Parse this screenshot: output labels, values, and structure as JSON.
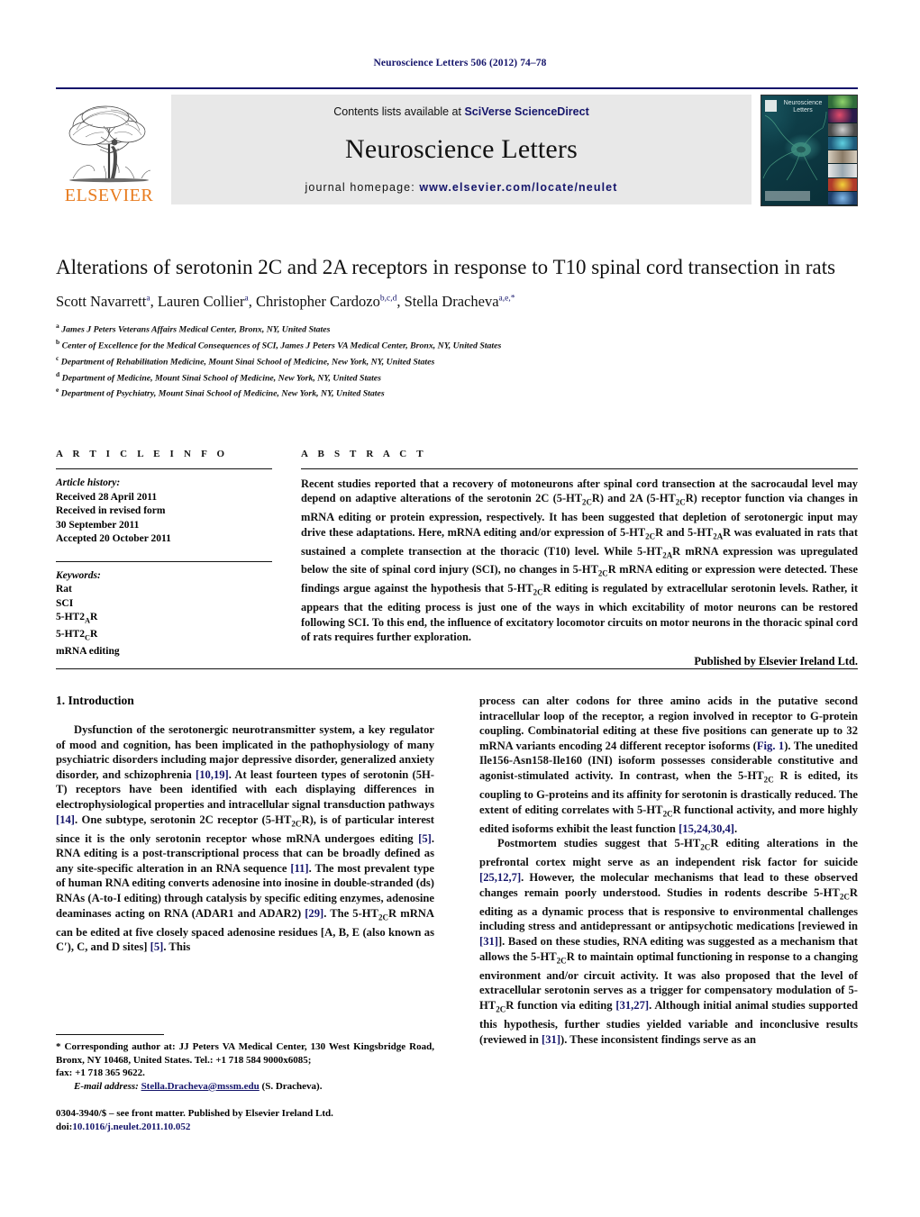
{
  "running_head": "Neuroscience Letters 506 (2012) 74–78",
  "masthead": {
    "contents_prefix": "Contents lists available at ",
    "contents_brand": "SciVerse ScienceDirect",
    "journal_title": "Neuroscience Letters",
    "homepage_prefix": "journal homepage: ",
    "homepage_url": "www.elsevier.com/locate/neulet",
    "publisher_logo_text": "ELSEVIER",
    "cover_title_line1": "Neuroscience",
    "cover_title_line2": "Letters"
  },
  "article": {
    "title": "Alterations of serotonin 2C and 2A receptors in response to T10 spinal cord transection in rats",
    "authors_html": "Scott Navarrett<sup>a</sup>, Lauren Collier<sup>a</sup>, Christopher Cardozo<sup>b,c,d</sup>, Stella Dracheva<sup>a,e,</sup><sup>*</sup>",
    "affiliations": [
      {
        "marker": "a",
        "text": "James J Peters Veterans Affairs Medical Center, Bronx, NY, United States"
      },
      {
        "marker": "b",
        "text": "Center of Excellence for the Medical Consequences of SCI, James J Peters VA Medical Center, Bronx, NY, United States"
      },
      {
        "marker": "c",
        "text": "Department of Rehabilitation Medicine, Mount Sinai School of Medicine, New York, NY, United States"
      },
      {
        "marker": "d",
        "text": "Department of Medicine, Mount Sinai School of Medicine, New York, NY, United States"
      },
      {
        "marker": "e",
        "text": "Department of Psychiatry, Mount Sinai School of Medicine, New York, NY, United States"
      }
    ]
  },
  "article_info": {
    "heading": "A R T I C L E   I N F O",
    "history_label": "Article history:",
    "history": [
      "Received 28 April 2011",
      "Received in revised form",
      "30 September 2011",
      "Accepted 20 October 2011"
    ],
    "keywords_label": "Keywords:",
    "keywords": [
      "Rat",
      "SCI",
      "5-HT2AR",
      "5-HT2CR",
      "mRNA editing"
    ]
  },
  "abstract": {
    "heading": "A B S T R A C T",
    "body_html": "Recent studies reported that a recovery of motoneurons after spinal cord transection at the sacrocaudal level may depend on adaptive alterations of the serotonin 2C (5-HT<sub>2C</sub>R) and 2A (5-HT<sub>2C</sub>R) receptor function via changes in mRNA editing or protein expression, respectively. It has been suggested that depletion of serotonergic input may drive these adaptations. Here, mRNA editing and/or expression of 5-HT<sub>2C</sub>R and 5-HT<sub>2A</sub>R was evaluated in rats that sustained a complete transection at the thoracic (T10) level. While 5-HT<sub>2A</sub>R mRNA expression was upregulated below the site of spinal cord injury (SCI), no changes in 5-HT<sub>2C</sub>R mRNA editing or expression were detected. These findings argue against the hypothesis that 5-HT<sub>2C</sub>R editing is regulated by extracellular serotonin levels. Rather, it appears that the editing process is just one of the ways in which excitability of motor neurons can be restored following SCI. To this end, the influence of excitatory locomotor circuits on motor neurons in the thoracic spinal cord of rats requires further exploration.",
    "published_by": "Published by Elsevier Ireland Ltd."
  },
  "body": {
    "section_number_title": "1.  Introduction",
    "left_column_html": "<p class=\"indent\">Dysfunction of the serotonergic neurotransmitter system, a key regulator of mood and cognition, has been implicated in the pathophysiology of many psychiatric disorders including major depressive disorder, generalized anxiety disorder, and schizophrenia <span class=\"ref\">[10,19]</span>. At least fourteen types of serotonin (5H-T) receptors have been identified with each displaying differences in electrophysiological properties and intracellular signal transduction pathways <span class=\"ref\">[14]</span>. One subtype, serotonin 2C receptor (5-HT<sub>2C</sub>R), is of particular interest since it is the only serotonin receptor whose mRNA undergoes editing <span class=\"ref\">[5]</span>. RNA editing is a post-transcriptional process that can be broadly defined as any site-specific alteration in an RNA sequence <span class=\"ref\">[11]</span>. The most prevalent type of human RNA editing converts adenosine into inosine in double-stranded (ds) RNAs (A-to-I editing) through catalysis by specific editing enzymes, adenosine deaminases acting on RNA (ADAR1 and ADAR2) <span class=\"ref\">[29]</span>. The 5-HT<sub>2C</sub>R mRNA can be edited at five closely spaced adenosine residues [A, B, E (also known as C&#8242;), C, and D sites] <span class=\"ref\">[5]</span>. This</p>",
    "right_column_html": "<p>process can alter codons for three amino acids in the putative second intracellular loop of the receptor, a region involved in receptor to G-protein coupling. Combinatorial editing at these five positions can generate up to 32 mRNA variants encoding 24 different receptor isoforms (<span class=\"ref\">Fig. 1</span>). The unedited Ile156-Asn158-Ile160 (INI) isoform possesses considerable constitutive and agonist-stimulated activity. In contrast, when the 5-HT<sub>2C</sub> R is edited, its coupling to G-proteins and its affinity for serotonin is drastically reduced. The extent of editing correlates with 5-HT<sub>2C</sub>R functional activity, and more highly edited isoforms exhibit the least function <span class=\"ref\">[15,24,30,4]</span>.</p><p class=\"indent\">Postmortem studies suggest that 5-HT<sub>2C</sub>R editing alterations in the prefrontal cortex might serve as an independent risk factor for suicide <span class=\"ref\">[25,12,7]</span>. However, the molecular mechanisms that lead to these observed changes remain poorly understood. Studies in rodents describe 5-HT<sub>2C</sub>R editing as a dynamic process that is responsive to environmental challenges including stress and antidepressant or antipsychotic medications [reviewed in <span class=\"ref\">[31]</span>]. Based on these studies, RNA editing was suggested as a mechanism that allows the 5-HT<sub>2C</sub>R to maintain optimal functioning in response to a changing environment and/or circuit activity. It was also proposed that the level of extracellular serotonin serves as a trigger for compensatory modulation of 5-HT<sub>2C</sub>R function via editing <span class=\"ref\">[31,27]</span>. Although initial animal studies supported this hypothesis, further studies yielded variable and inconclusive results (reviewed in <span class=\"ref\">[31]</span>). These inconsistent findings serve as an</p>"
  },
  "footnote": {
    "corresponding_html": "<span>*</span> Corresponding author at: JJ Peters VA Medical Center, 130 West Kingsbridge Road, Bronx, NY 10468, United States. Tel.: +1 718 584 9000x6085;<br>fax: +1 718 365 9622.",
    "email_label": "E-mail address:",
    "email": "Stella.Dracheva@mssm.edu",
    "email_owner": "(S. Dracheva).",
    "imprint_line1": "0304-3940/$ – see front matter. Published by Elsevier Ireland Ltd.",
    "doi_label": "doi:",
    "doi_value": "10.1016/j.neulet.2011.10.052"
  },
  "colors": {
    "link_blue": "#15156b",
    "elsevier_orange": "#e87b1e",
    "masthead_grey": "#e8e8e8"
  }
}
